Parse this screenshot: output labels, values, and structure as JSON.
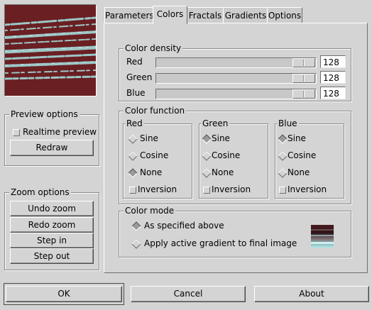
{
  "preview": {
    "name": "fractal-preview"
  },
  "preview_options": {
    "title": "Preview options",
    "realtime_label": "Realtime preview",
    "realtime_checked": false,
    "redraw_label": "Redraw"
  },
  "zoom_options": {
    "title": "Zoom options",
    "undo_label": "Undo zoom",
    "redo_label": "Redo zoom",
    "step_in_label": "Step in",
    "step_out_label": "Step out"
  },
  "tabs": [
    {
      "label": "Parameters",
      "active": false
    },
    {
      "label": "Colors",
      "active": true
    },
    {
      "label": "Fractals",
      "active": false
    },
    {
      "label": "Gradients",
      "active": false
    },
    {
      "label": "Options",
      "active": false
    }
  ],
  "color_density": {
    "title": "Color density",
    "channels": [
      {
        "label": "Red",
        "value": "128",
        "level": 0.96
      },
      {
        "label": "Green",
        "value": "128",
        "level": 0.96
      },
      {
        "label": "Blue",
        "value": "128",
        "level": 0.96
      }
    ]
  },
  "color_function": {
    "title": "Color function",
    "groups": [
      {
        "title": "Red",
        "options": [
          "Sine",
          "Cosine",
          "None"
        ],
        "selected": 2,
        "inversion_label": "Inversion",
        "inversion_checked": false
      },
      {
        "title": "Green",
        "options": [
          "Sine",
          "Cosine",
          "None"
        ],
        "selected": 0,
        "inversion_label": "Inversion",
        "inversion_checked": false
      },
      {
        "title": "Blue",
        "options": [
          "Sine",
          "Cosine",
          "None"
        ],
        "selected": 0,
        "inversion_label": "Inversion",
        "inversion_checked": false
      }
    ]
  },
  "color_mode": {
    "title": "Color mode",
    "options": [
      "As specified above",
      "Apply active gradient to final image"
    ],
    "selected": 0
  },
  "dialog_buttons": {
    "ok_label": "OK",
    "cancel_label": "Cancel",
    "about_label": "About"
  },
  "colors": {
    "preview_bg": "#6a1f22",
    "preview_streak": "#9cc7c7",
    "gradient_top": "#4a1a1f",
    "gradient_bottom": "#a9eaea"
  }
}
